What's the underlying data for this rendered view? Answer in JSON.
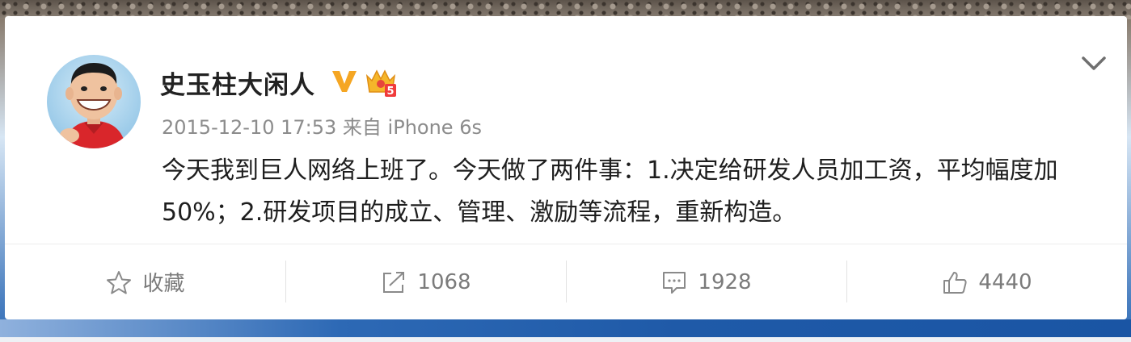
{
  "post": {
    "username": "史玉柱大闲人",
    "verified_badge": "v-verified-icon",
    "member_badge": "crown-level-icon",
    "member_level": "5",
    "timestamp": "2015-12-10 17:53",
    "source": "来自 iPhone 6s",
    "text": "今天我到巨人网络上班了。今天做了两件事：1.决定给研发人员加工资，平均幅度加50%；2.研发项目的成立、管理、激励等流程，重新构造。"
  },
  "actions": {
    "favorite_label": "收藏",
    "repost_count": "1068",
    "comment_count": "1928",
    "like_count": "4440"
  },
  "colors": {
    "badge_gold": "#f5a623",
    "text_primary": "#1e1e1e",
    "text_secondary": "#8c8c8c"
  }
}
